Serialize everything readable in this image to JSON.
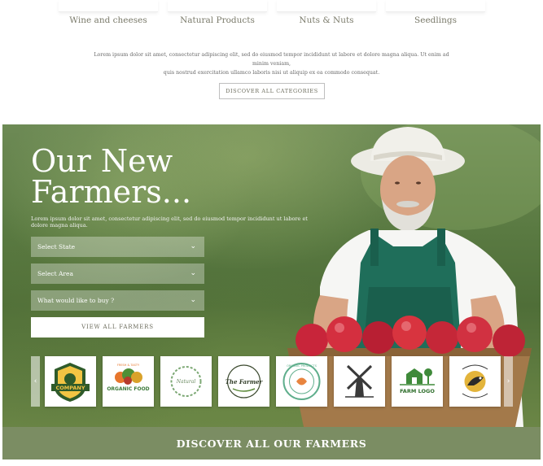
{
  "categories": [
    {
      "label": "Wine and cheeses"
    },
    {
      "label": "Natural Products"
    },
    {
      "label": "Nuts & Nuts"
    },
    {
      "label": "Seedlings"
    }
  ],
  "intro": {
    "line1": "Lorem ipsum dolor sit amet, consectetur adipiscing elit, sed do eiusmod tempor incididunt ut labore et dolore magna aliqua. Ut enim ad minim veniam,",
    "line2": "quis nostrud exercitation ullamco laboris nisi ut aliquip ex ea commodo consequat."
  },
  "discover_categories_label": "DISCOVER ALL CATEGORIES",
  "hero": {
    "title_line1": "Our New",
    "title_line2": "Farmers...",
    "subtitle": "Lorem ipsum dolor sit amet, consectetur adipiscing elit, sed do eiusmod tempor incididunt ut labore et dolore magna aliqua.",
    "select_state": "Select State",
    "select_area": "Select Area",
    "select_buy": "What would like to buy ?",
    "view_all_label": "VIEW ALL FARMERS"
  },
  "logos": [
    {
      "icon": "company-badge-logo",
      "text": "COMPANY"
    },
    {
      "icon": "organic-food-logo",
      "text": "ORGANIC FOOD"
    },
    {
      "icon": "natural-wreath-logo",
      "text": "Natural"
    },
    {
      "icon": "the-farmer-logo",
      "text": "The Farmer"
    },
    {
      "icon": "organic-products-logo",
      "text": "ORGANIC PRODUCTS"
    },
    {
      "icon": "windmill-logo",
      "text": ""
    },
    {
      "icon": "farm-logo",
      "text": "FARM LOGO"
    },
    {
      "icon": "bird-photography-logo",
      "text": ""
    }
  ],
  "carousel": {
    "prev": "‹",
    "next": "›"
  },
  "discover_farmers_label": "DISCOVER ALL OUR FARMERS",
  "colors": {
    "accent": "#7b8d63",
    "category_text": "#7a7a6a"
  }
}
